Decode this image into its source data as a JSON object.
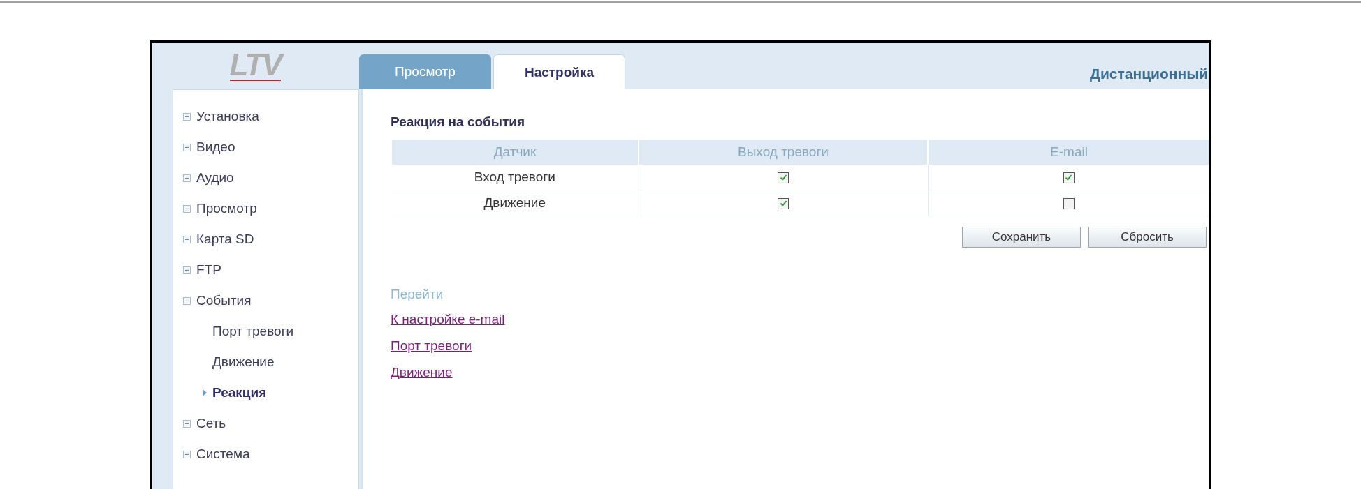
{
  "logo": "LTV",
  "tabs": [
    {
      "label": "Просмотр",
      "selected": false
    },
    {
      "label": "Настройка",
      "selected": true
    }
  ],
  "header_title": "Дистанционный",
  "sidebar": {
    "items": [
      {
        "label": "Установка",
        "selected": false
      },
      {
        "label": "Видео",
        "selected": false
      },
      {
        "label": "Аудио",
        "selected": false
      },
      {
        "label": "Просмотр",
        "selected": false
      },
      {
        "label": "Карта SD",
        "selected": false
      },
      {
        "label": "FTP",
        "selected": false
      },
      {
        "label": "События",
        "selected": false,
        "children": [
          {
            "label": "Порт тревоги",
            "selected": false
          },
          {
            "label": "Движение",
            "selected": false
          },
          {
            "label": "Реакция",
            "selected": true
          }
        ]
      },
      {
        "label": "Сеть",
        "selected": false
      },
      {
        "label": "Система",
        "selected": false
      }
    ]
  },
  "section_title": "Реакция на события",
  "table": {
    "columns": [
      "Датчик",
      "Выход тревоги",
      "E-mail"
    ],
    "rows": [
      {
        "sensor": "Вход тревоги",
        "alarm_out": true,
        "email": true
      },
      {
        "sensor": "Движение",
        "alarm_out": true,
        "email": false
      }
    ]
  },
  "buttons": [
    "Сохранить",
    "Сбросить"
  ],
  "goto_label": "Перейти",
  "links": [
    "К настройке e-mail",
    "Порт тревоги",
    "Движение"
  ]
}
